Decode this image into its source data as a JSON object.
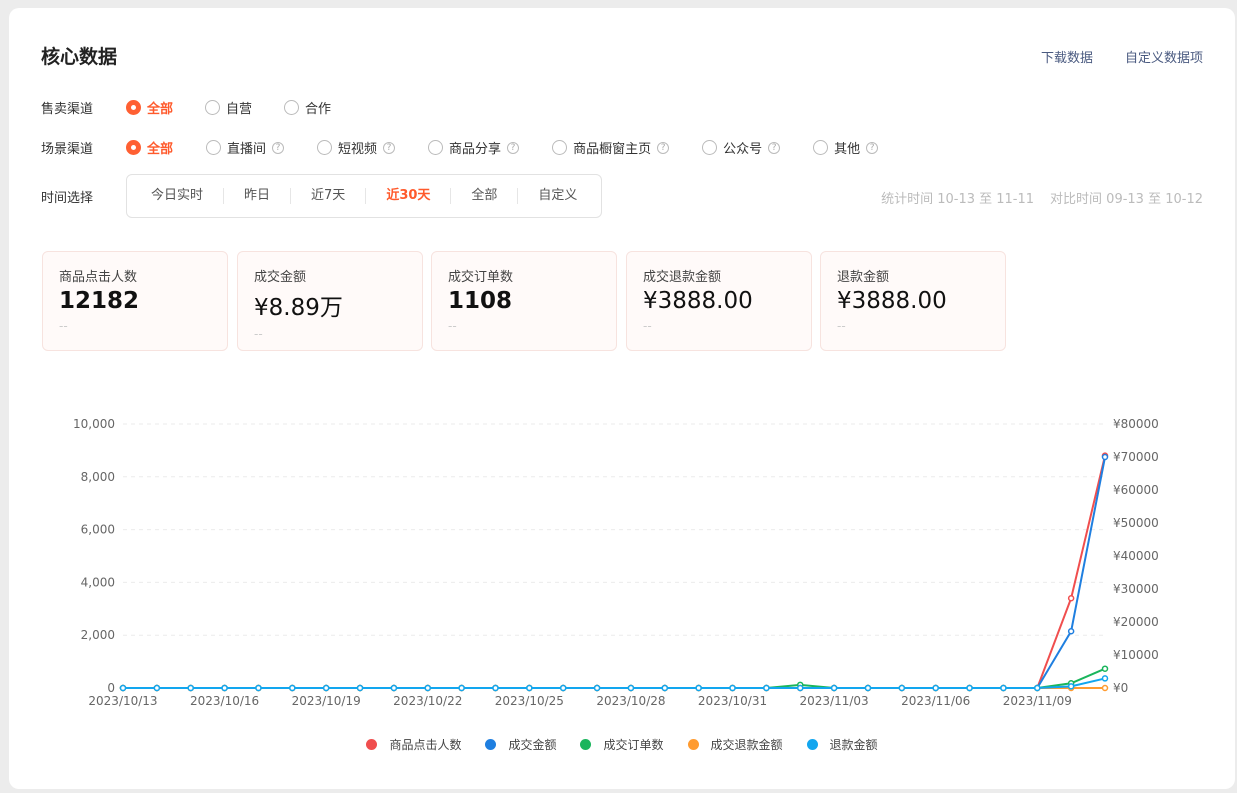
{
  "header": {
    "title": "核心数据",
    "download_label": "下载数据",
    "customize_label": "自定义数据项"
  },
  "sales_channel": {
    "label": "售卖渠道",
    "options": [
      {
        "label": "全部",
        "selected": true
      },
      {
        "label": "自营",
        "selected": false
      },
      {
        "label": "合作",
        "selected": false
      }
    ]
  },
  "scene_channel": {
    "label": "场景渠道",
    "options": [
      {
        "label": "全部",
        "selected": true,
        "help": false
      },
      {
        "label": "直播间",
        "selected": false,
        "help": true
      },
      {
        "label": "短视频",
        "selected": false,
        "help": true
      },
      {
        "label": "商品分享",
        "selected": false,
        "help": true
      },
      {
        "label": "商品橱窗主页",
        "selected": false,
        "help": true
      },
      {
        "label": "公众号",
        "selected": false,
        "help": true
      },
      {
        "label": "其他",
        "selected": false,
        "help": true
      }
    ],
    "help_glyph": "?"
  },
  "time_select": {
    "label": "时间选择",
    "options": [
      {
        "label": "今日实时",
        "selected": false
      },
      {
        "label": "昨日",
        "selected": false
      },
      {
        "label": "近7天",
        "selected": false
      },
      {
        "label": "近30天",
        "selected": true
      },
      {
        "label": "全部",
        "selected": false
      },
      {
        "label": "自定义",
        "selected": false
      }
    ],
    "stat_time": "统计时间 10-13 至 11-11",
    "compare_time": "对比时间 09-13 至 10-12"
  },
  "metrics": [
    {
      "label": "商品点击人数",
      "value": "12182",
      "compare": "--",
      "bold": true
    },
    {
      "label": "成交金额",
      "value": "¥8.89万",
      "compare": "--",
      "bold": false
    },
    {
      "label": "成交订单数",
      "value": "1108",
      "compare": "--",
      "bold": true
    },
    {
      "label": "成交退款金额",
      "value": "¥3888.00",
      "compare": "--",
      "bold": false
    },
    {
      "label": "退款金额",
      "value": "¥3888.00",
      "compare": "--",
      "bold": false
    }
  ],
  "chart_data": {
    "type": "line",
    "x": [
      "2023/10/13",
      "2023/10/14",
      "2023/10/15",
      "2023/10/16",
      "2023/10/17",
      "2023/10/18",
      "2023/10/19",
      "2023/10/20",
      "2023/10/21",
      "2023/10/22",
      "2023/10/23",
      "2023/10/24",
      "2023/10/25",
      "2023/10/26",
      "2023/10/27",
      "2023/10/28",
      "2023/10/29",
      "2023/10/30",
      "2023/10/31",
      "2023/11/01",
      "2023/11/02",
      "2023/11/03",
      "2023/11/04",
      "2023/11/05",
      "2023/11/06",
      "2023/11/07",
      "2023/11/08",
      "2023/11/09",
      "2023/11/10",
      "2023/11/11"
    ],
    "x_tick_labels": [
      "2023/10/13",
      "2023/10/16",
      "2023/10/19",
      "2023/10/22",
      "2023/10/25",
      "2023/10/28",
      "2023/10/31",
      "2023/11/03",
      "2023/11/06",
      "2023/11/09"
    ],
    "y_left": {
      "ticks": [
        "0",
        "2,000",
        "4,000",
        "6,000",
        "8,000",
        "10,000"
      ],
      "range": [
        0,
        10000
      ]
    },
    "y_right": {
      "ticks": [
        "¥0",
        "¥10000",
        "¥20000",
        "¥30000",
        "¥40000",
        "¥50000",
        "¥60000",
        "¥70000",
        "¥80000"
      ],
      "range": [
        0,
        80000
      ]
    },
    "grid": "horizontal dashed",
    "legend_position": "bottom",
    "series": [
      {
        "name": "商品点击人数",
        "color": "#f04e4e",
        "axis": "left",
        "values": [
          0,
          0,
          0,
          0,
          0,
          0,
          0,
          0,
          0,
          0,
          0,
          0,
          0,
          0,
          0,
          0,
          0,
          0,
          0,
          0,
          0,
          0,
          0,
          0,
          0,
          0,
          0,
          0,
          3400,
          8800
        ]
      },
      {
        "name": "成交金额",
        "color": "#1f7fe0",
        "axis": "right",
        "values": [
          0,
          0,
          0,
          0,
          0,
          0,
          0,
          0,
          0,
          0,
          0,
          0,
          0,
          0,
          0,
          0,
          0,
          0,
          0,
          0,
          0,
          0,
          0,
          0,
          0,
          0,
          0,
          0,
          17200,
          70000
        ]
      },
      {
        "name": "成交订单数",
        "color": "#1ab55c",
        "axis": "left",
        "values": [
          0,
          0,
          0,
          0,
          0,
          0,
          0,
          0,
          0,
          0,
          0,
          0,
          0,
          0,
          0,
          0,
          0,
          0,
          0,
          0,
          120,
          0,
          0,
          0,
          0,
          0,
          0,
          0,
          180,
          730
        ]
      },
      {
        "name": "成交退款金额",
        "color": "#ff9b30",
        "axis": "right",
        "values": [
          0,
          0,
          0,
          0,
          0,
          0,
          0,
          0,
          0,
          0,
          0,
          0,
          0,
          0,
          0,
          0,
          0,
          0,
          0,
          0,
          0,
          0,
          0,
          0,
          0,
          0,
          0,
          0,
          0,
          0
        ]
      },
      {
        "name": "退款金额",
        "color": "#12a6ef",
        "axis": "right",
        "values": [
          0,
          0,
          0,
          0,
          0,
          0,
          0,
          0,
          0,
          0,
          0,
          0,
          0,
          0,
          0,
          0,
          0,
          0,
          0,
          0,
          0,
          0,
          0,
          0,
          0,
          0,
          0,
          0,
          500,
          2900
        ]
      }
    ]
  }
}
